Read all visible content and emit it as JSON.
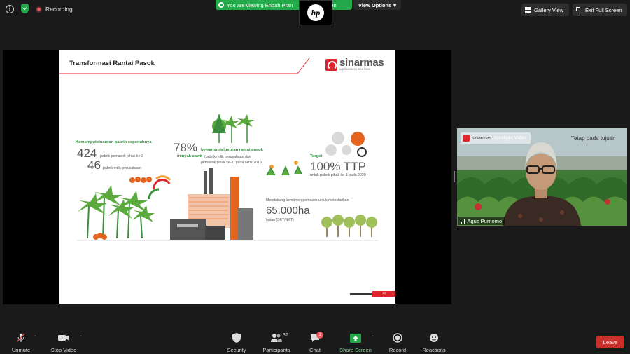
{
  "topbar": {
    "recording_label": "Recording",
    "viewing_banner": "You are viewing Endah Pran",
    "viewing_banner_tail": "en",
    "view_options_label": "View Options",
    "gallery_view_label": "Gallery View",
    "exit_fullscreen_label": "Exit Full Screen",
    "overlay_logo": "hp"
  },
  "slide": {
    "title": "Transformasi Rantai Pasok",
    "brand_name": "sinarmas",
    "brand_sub": "agribusiness and food",
    "block1": {
      "heading": "Kemamputelusuran pabrik sepenuhnya",
      "value1": "424",
      "label1": "pabrik pemasok pihak ke-3",
      "value2": "46",
      "label2": "pabrik milik perusahaan"
    },
    "block2": {
      "value": "78%",
      "heading": "kemamputelusuran rantai pasok",
      "heading2": "minyak sawit",
      "note1": "(pabrik milik perusahaan dan",
      "note2": "pemasok pihak ke-3) pada akhir 2019"
    },
    "block3": {
      "heading": "Target",
      "value": "100% TTP",
      "label": "untuk pabrik pihak ke-3 pada 2020"
    },
    "block4": {
      "heading1": "Mendukung komitmen pemasok untuk melestarikan",
      "value": "65.000ha",
      "label": "hutan (SKT/NKT)"
    },
    "page_number": "10"
  },
  "video": {
    "tag_text": "Spotlight Video",
    "tag_brand": "sinarmas",
    "background_text": "Tetap pada tujuan",
    "participant_name": "Agus Purnomo"
  },
  "toolbar": {
    "unmute": "Unmute",
    "stop_video": "Stop Video",
    "security": "Security",
    "participants": "Participants",
    "participants_count": "32",
    "chat": "Chat",
    "chat_badge": "1",
    "share_screen": "Share Screen",
    "record": "Record",
    "reactions": "Reactions",
    "leave": "Leave"
  },
  "colors": {
    "zoom_green": "#23a94a",
    "brand_red": "#e0242b",
    "leave_red": "#c9302c",
    "slide_green": "#2f8a3e"
  }
}
